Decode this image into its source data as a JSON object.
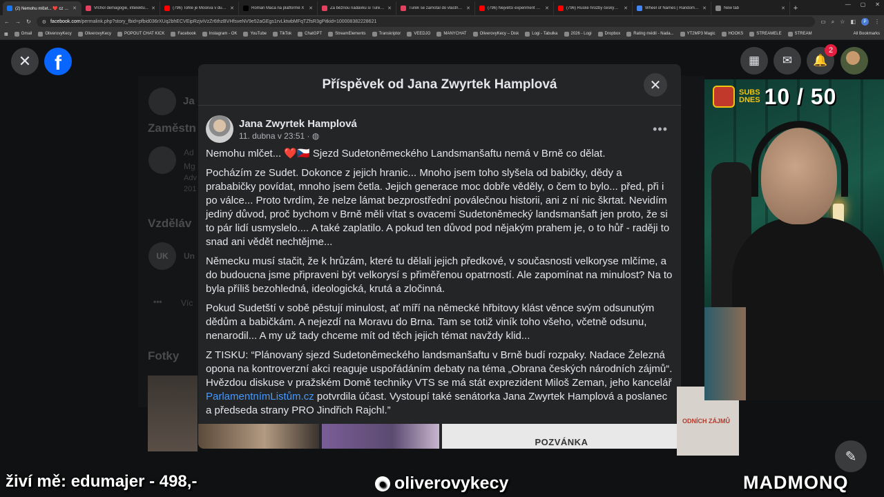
{
  "browser": {
    "tabs": [
      {
        "label": "(2) Nemohu mlčet... ❤️ cz Sje...",
        "color": "#1877f2",
        "active": true
      },
      {
        "label": "Vrchol demagogie, intelektu...",
        "color": "#e4405f",
        "active": false
      },
      {
        "label": "(796) Tohle je Moskva v dubn...",
        "color": "#ff0000",
        "active": false
      },
      {
        "label": "Roman Maca na platformě X",
        "color": "#000000",
        "active": false
      },
      {
        "label": "Za běžnou nadávku si Turek...",
        "color": "#e4405f",
        "active": false
      },
      {
        "label": "Turek se zamotal do vlastních...",
        "color": "#e4405f",
        "active": false
      },
      {
        "label": "(796) Největší experiment s ...",
        "color": "#ff0000",
        "active": false
      },
      {
        "label": "(796) Ruské hrozby českým ...",
        "color": "#ff0000",
        "active": false
      },
      {
        "label": "Wheel of Names | Random na...",
        "color": "#4285f4",
        "active": false
      },
      {
        "label": "New tab",
        "color": "#888888",
        "active": false
      }
    ],
    "url_domain": "facebook.com",
    "url_path": "/permalink.php?story_fbid=pfbid036rXUq2bhECVEipRzjviVzZr6thzBVHfsveNV9e52aGEgs1rvLktwbMFqTZfsR3gPitkid=100008382228621"
  },
  "bookmarks": [
    "Gmail",
    "OliverovyKecy",
    "OliverovyKecy",
    "POPOUT CHAT KICK",
    "Facebook",
    "Instagram - OK",
    "YouTube",
    "TikTok",
    "ChatGPT",
    "StreamElements",
    "Transkriptor",
    "VEEDJO",
    "MANYCHAT",
    "OliverovyKecy – Disk",
    "Logi - Tabulka",
    "2026 - Logi",
    "Dropbox",
    "Rating médií - Nada...",
    "YT2MP3 Magic",
    "HOOKS",
    "STREAMELE",
    "STREAM"
  ],
  "bookmarks_all": "All Bookmarks",
  "background": {
    "heading1": "Zaměstn",
    "heading2": "Vzděláv",
    "heading3": "Fotky",
    "frag_ad": "Ad",
    "frag_mg": "Mg",
    "frag_adv": "Adv",
    "frag_201": "201",
    "frag_un": "Un",
    "frag_vic": "Víc",
    "frag_ja": "Ja",
    "frag_uk": "UK"
  },
  "nav": {
    "notification_count": "2"
  },
  "modal": {
    "title": "Příspěvek od Jana Zwyrtek Hamplová",
    "author": "Jana Zwyrtek Hamplová",
    "date": "11. dubna v 23:51 · ",
    "more": "•••",
    "p1": "Nemohu mlčet... ❤️🇨🇿 Sjezd Sudetoněmeckého Landsmanšaftu nemá v Brně co dělat.",
    "p2": "Pocházím ze Sudet. Dokonce z jejich hranic... Mnoho jsem toho slyšela od babičky, dědy a prababičky povídat, mnoho jsem četla. Jejich generace moc dobře věděly, o čem to bylo... před, při i po válce... Proto tvrdím, že nelze lámat bezprostřední  poválečnou historii, ani z ní nic škrtat.  Nevidím jediný důvod, proč bychom v Brně měli vítat s ovacemi Sudetoněmecký landsmanšaft jen proto, že si to pár lidí usmyslelo.... A také zaplatilo. A pokud ten důvod pod nějakým prahem je, o to hůř - raději to snad ani vědět nechtějme...",
    "p3": "Německu musí stačit, že k hrůzám, které tu dělali jejich předkové, v současnosti velkoryse mlčíme, a do budoucna jsme připraveni být velkorysí s přiměřenou opatrností. Ale zapomínat na minulost? Na to byla příliš bezohledná, ideologická, krutá a zločinná.",
    "p4": "Pokud Sudetští v sobě pěstují minulost, ať míří na německé hřbitovy klást věnce svým odsunutým dědům a babičkám. A nejezdí na Moravu do Brna. Tam se totiž viník toho všeho, včetně odsunu, nenarodil... A my už tady chceme mít od těch jejich témat navždy klid...",
    "p5_a": "Z TISKU: “Plánovaný sjezd Sudetoněmeckého landsmanšaftu v Brně budí rozpaky. Nadace Železná opona na kontroverzní akci reaguje uspořádáním debaty na téma „Obrana českých národních zájmů“. Hvězdou diskuse v pražském Domě techniky VTS se má stát exprezident Miloš Zeman, jeho kancelář ",
    "p5_link": "ParlamentnímListům.cz",
    "p5_b": " potvrdila účast. Vystoupí také senátorka Jana Zwyrtek Hamplová a poslanec a předseda strany PRO Jindřich Rajchl.”",
    "image_caption": "POZVÁNKA"
  },
  "webcam": {
    "subs_label_1": "SUBS",
    "subs_label_2": "DNES",
    "subs_count": "10 / 50",
    "behind_text": "ODNÍCH ZÁJMŮ"
  },
  "overlay": {
    "left": "živí mě: edumajer - 498,-",
    "middle": "oliverovykecy",
    "right": "MADMONQ"
  }
}
